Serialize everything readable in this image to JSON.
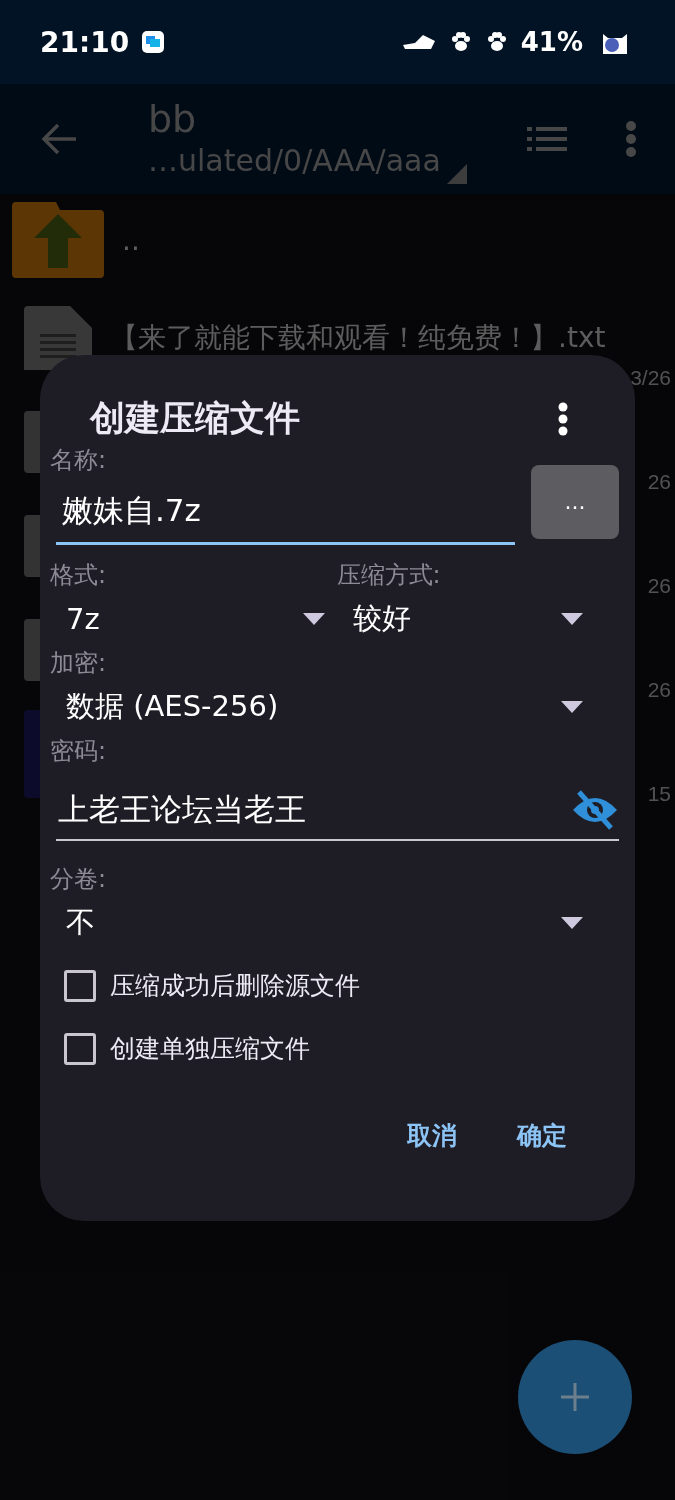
{
  "status_bar": {
    "time": "21:10",
    "battery": "41%"
  },
  "toolbar": {
    "title": "bb",
    "path": "…ulated/0/AAA/aaa"
  },
  "file_list": [
    {
      "kind": "parent",
      "name": ".."
    },
    {
      "kind": "text",
      "name": "【来了就能下载和观看！纯免费！】.txt",
      "date": "3/26"
    },
    {
      "kind": "file",
      "date": "26"
    },
    {
      "kind": "file",
      "date": "26"
    },
    {
      "kind": "file",
      "date": "26"
    },
    {
      "kind": "app",
      "date": "15"
    }
  ],
  "dialog": {
    "title": "创建压缩文件",
    "name_label": "名称:",
    "name_value": "嫩妹自.7z",
    "name_focused": true,
    "browse_button": "...",
    "format_label": "格式:",
    "format_value": "7z",
    "method_label": "压缩方式:",
    "method_value": "较好",
    "encryption_label": "加密:",
    "encryption_value": "数据 (AES-256)",
    "password_label": "密码:",
    "password_value": "上老王论坛当老王",
    "password_visible": true,
    "volume_label": "分卷:",
    "volume_value": "不",
    "checkboxes": [
      {
        "label": "压缩成功后删除源文件",
        "checked": false
      },
      {
        "label": "创建单独压缩文件",
        "checked": false
      }
    ],
    "buttons": [
      "取消",
      "确定"
    ]
  }
}
